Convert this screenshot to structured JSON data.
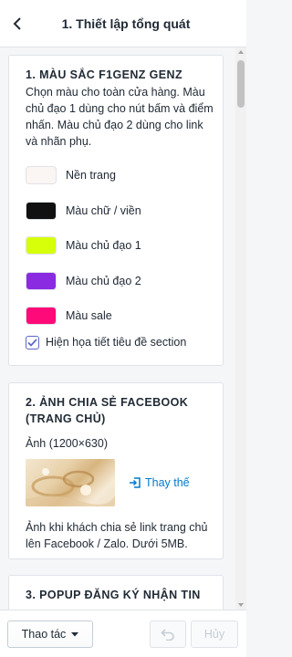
{
  "header": {
    "title": "1. Thiết lập tổng quát",
    "back_icon": "chevron-left-icon"
  },
  "section1": {
    "title": "1. MÀU SẮC F1GENZ GENZ",
    "description": "Chọn màu cho toàn cửa hàng. Màu chủ đạo 1 dùng cho nút bấm và điểm nhấn. Màu chủ đạo 2 dùng cho link và nhãn phụ.",
    "colors": [
      {
        "label": "Nền trang",
        "color": "#fbf5f3"
      },
      {
        "label": "Màu chữ / viền",
        "color": "#111111"
      },
      {
        "label": "Màu chủ đạo 1",
        "color": "#d6ff0a"
      },
      {
        "label": "Màu chủ đạo 2",
        "color": "#8a2be2"
      },
      {
        "label": "Màu sale",
        "color": "#ff0a78"
      }
    ],
    "checkbox": {
      "label": "Hiện họa tiết tiêu đề section",
      "checked": true
    }
  },
  "section2": {
    "title": "2. ẢNH CHIA SẺ FACEBOOK (TRANG CHỦ)",
    "image_label": "Ảnh (1200×630)",
    "replace_label": "Thay thế",
    "help": "Ảnh khi khách chia sẻ link trang chủ lên Facebook / Zalo. Dưới 5MB."
  },
  "section3": {
    "title": "3. POPUP ĐĂNG KÝ NHẬN TIN"
  },
  "footer": {
    "actions_label": "Thao tác",
    "cancel_label": "Hủy"
  },
  "colors": {
    "accent": "#5c6ac4",
    "link": "#007ace"
  }
}
